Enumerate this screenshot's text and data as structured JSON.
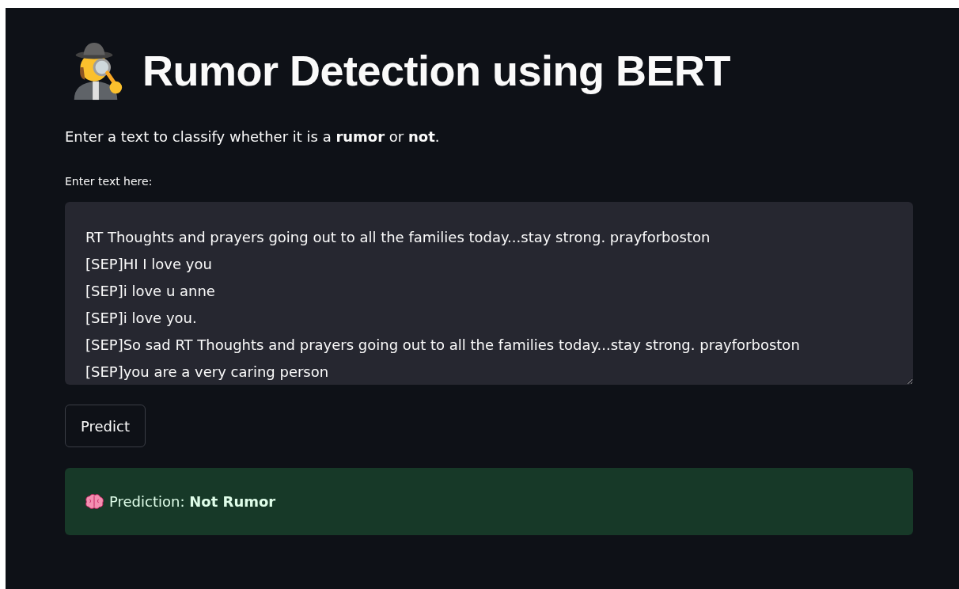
{
  "title": "Rumor Detection using BERT",
  "description": "Enter a text to classify whether it is a **rumor** or **not**.",
  "input": {
    "label": "Enter text here:",
    "value": "RT Thoughts and prayers going out to all the families today...stay strong. prayforboston\n[SEP]HI I love you\n[SEP]i love u anne\n[SEP]i love you.\n[SEP]So sad RT Thoughts and prayers going out to all the families today...stay strong. prayforboston\n[SEP]you are a very caring person"
  },
  "button": {
    "label": "Predict"
  },
  "result": {
    "kind": "success",
    "text": "Prediction: **Not Rumor**"
  }
}
